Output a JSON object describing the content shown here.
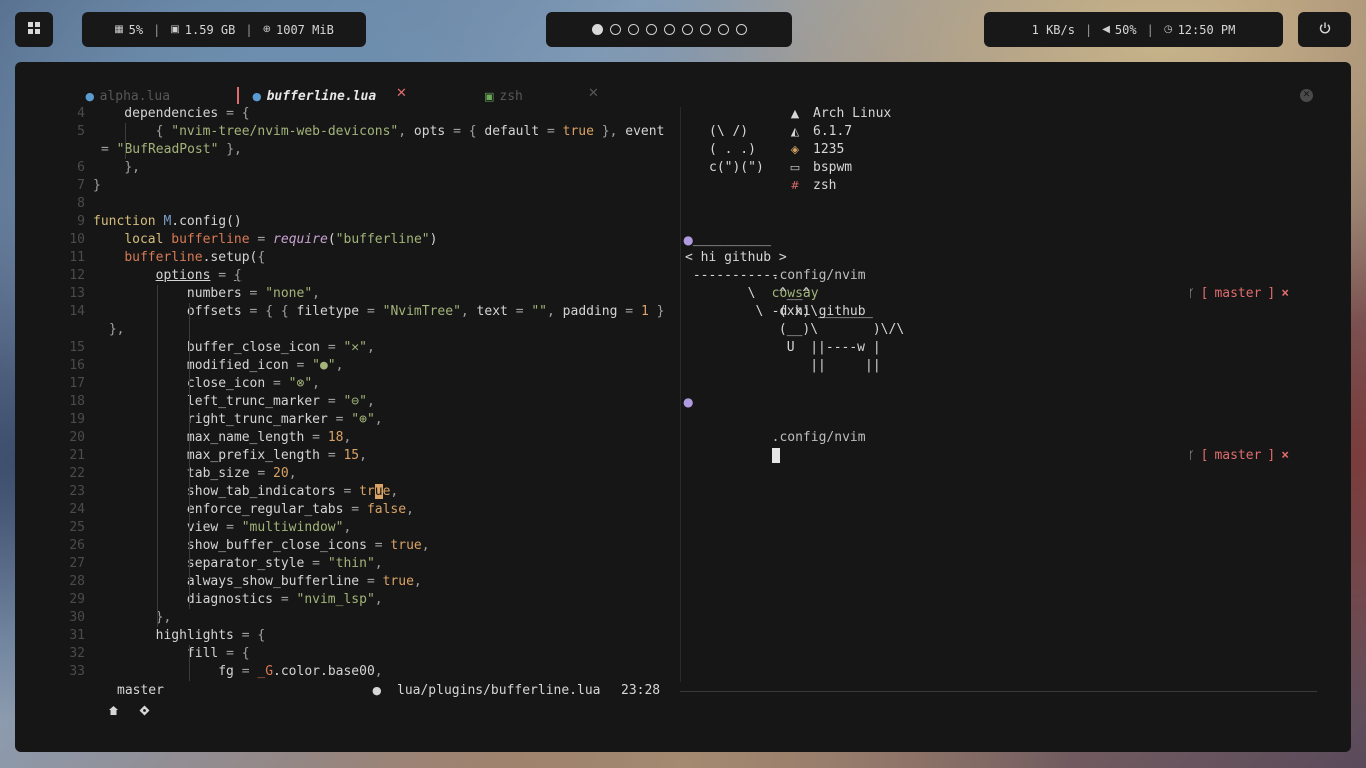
{
  "topbar": {
    "menu_icon": "grid-icon",
    "cpu": "5%",
    "memory": "1.59 GB",
    "swap": "1007 MiB",
    "workspaces": [
      true,
      false,
      false,
      false,
      false,
      false,
      false,
      false,
      false
    ],
    "net": "1 KB/s",
    "volume": "50%",
    "clock": "12:50 PM",
    "separator": "|"
  },
  "tabs": [
    {
      "label": "alpha.lua",
      "active": false
    },
    {
      "label": "bufferline.lua",
      "active": true
    },
    {
      "label": "zsh",
      "active": false
    }
  ],
  "tab_close_glyph": "✕",
  "editor": {
    "lines": [
      {
        "n": "4",
        "html": "    dependencies <span class='p'>=</span> <span class='p'>{</span>"
      },
      {
        "n": "5",
        "html": "        <span class='p'>{</span> <span class='s'>\"nvim-tree/nvim-web-devicons\"</span><span class='p'>,</span> opts <span class='p'>=</span> <span class='p'>{</span> default <span class='p'>=</span> <span class='n'>true</span> <span class='p'>},</span> event"
      },
      {
        "n": "",
        "html": "<span class='p'>=</span> <span class='s'>\"BufReadPost\"</span> <span class='p'>},</span>",
        "wrap": true
      },
      {
        "n": "6",
        "html": "    <span class='p'>},</span>"
      },
      {
        "n": "7",
        "html": "<span class='p'>}</span>"
      },
      {
        "n": "8",
        "html": ""
      },
      {
        "n": "9",
        "html": "<span class='k'>function</span> <span class='b'>M</span>.config()"
      },
      {
        "n": "10",
        "html": "    <span class='k'>local</span> <span class='r'>bufferline</span> <span class='p'>=</span> <span class='it'>require</span>(<span class='s'>\"bufferline\"</span>)"
      },
      {
        "n": "11",
        "html": "    <span class='r'>bufferline</span>.setup(<span class='p'>{</span>"
      },
      {
        "n": "12",
        "html": "        <span class='ul'>options</span> <span class='p'>=</span> <span class='p ul'>{</span>"
      },
      {
        "n": "13",
        "html": "            numbers <span class='p'>=</span> <span class='s'>\"none\"</span><span class='p'>,</span>"
      },
      {
        "n": "14",
        "html": "            offsets <span class='p'>=</span> <span class='p'>{</span> <span class='p'>{</span> filetype <span class='p'>=</span> <span class='s'>\"NvimTree\"</span><span class='p'>,</span> text <span class='p'>=</span> <span class='s'>\"\"</span><span class='p'>,</span> padding <span class='p'>=</span> <span class='n'>1</span> <span class='p'>}</span>"
      },
      {
        "n": "",
        "html": " <span class='p'>},</span>",
        "wrap": true
      },
      {
        "n": "15",
        "html": "            buffer_close_icon <span class='p'>=</span> <span class='s'>\"✕\"</span><span class='p'>,</span>"
      },
      {
        "n": "16",
        "html": "            modified_icon <span class='p'>=</span> <span class='s'>\"●\"</span><span class='p'>,</span>"
      },
      {
        "n": "17",
        "html": "            close_icon <span class='p'>=</span> <span class='s'>\"⊗\"</span><span class='p'>,</span>"
      },
      {
        "n": "18",
        "html": "            left_trunc_marker <span class='p'>=</span> <span class='s'>\"⊖\"</span><span class='p'>,</span>"
      },
      {
        "n": "19",
        "html": "            right_trunc_marker <span class='p'>=</span> <span class='s'>\"⊕\"</span><span class='p'>,</span>"
      },
      {
        "n": "20",
        "html": "            max_name_length <span class='p'>=</span> <span class='n'>18</span><span class='p'>,</span>"
      },
      {
        "n": "21",
        "html": "            max_prefix_length <span class='p'>=</span> <span class='n'>15</span><span class='p'>,</span>"
      },
      {
        "n": "22",
        "html": "            tab_size <span class='p'>=</span> <span class='n'>20</span><span class='p'>,</span>"
      },
      {
        "n": "23",
        "html": "            show_tab_indicators <span class='p'>=</span> <span class='n'>tr<span class='cursor'>u</span>e</span><span class='p'>,</span>"
      },
      {
        "n": "24",
        "html": "            enforce_regular_tabs <span class='p'>=</span> <span class='n'>false</span><span class='p'>,</span>"
      },
      {
        "n": "25",
        "html": "            view <span class='p'>=</span> <span class='s'>\"multiwindow\"</span><span class='p'>,</span>"
      },
      {
        "n": "26",
        "html": "            show_buffer_close_icons <span class='p'>=</span> <span class='n'>true</span><span class='p'>,</span>"
      },
      {
        "n": "27",
        "html": "            separator_style <span class='p'>=</span> <span class='s'>\"thin\"</span><span class='p'>,</span>"
      },
      {
        "n": "28",
        "html": "            always_show_bufferline <span class='p'>=</span> <span class='n'>true</span><span class='p'>,</span>"
      },
      {
        "n": "29",
        "html": "            diagnostics <span class='p'>=</span> <span class='s'>\"nvim_lsp\"</span><span class='p'>,</span>"
      },
      {
        "n": "30",
        "html": "        <span class='p'>},</span>"
      },
      {
        "n": "31",
        "html": "        highlights <span class='p'>=</span> <span class='p'>{</span>"
      },
      {
        "n": "32",
        "html": "            fill <span class='p'>=</span> <span class='p'>{</span>"
      },
      {
        "n": "33",
        "html": "                fg <span class='p'>=</span> <span class='r'>_G</span>.color.base00<span class='p'>,</span>"
      }
    ]
  },
  "terminal": {
    "cat_ascii": [
      "(\\ /)",
      "( . .)",
      "c(\")(\")"
    ],
    "info": [
      {
        "icon": "arch-icon",
        "glyph": "▲",
        "color": "#d6d6d6",
        "text": "Arch Linux"
      },
      {
        "icon": "linux-tux-icon",
        "glyph": "◭",
        "color": "#d6d6d6",
        "text": "6.1.7"
      },
      {
        "icon": "package-icon",
        "glyph": "◈",
        "color": "#d9a365",
        "text": "1235"
      },
      {
        "icon": "monitor-icon",
        "glyph": "▭",
        "color": "#d6d6d6",
        "text": "bspwm"
      },
      {
        "icon": "hash-icon",
        "glyph": "#",
        "color": "#e06c6c",
        "text": "zsh"
      }
    ],
    "prompt1": {
      "dir": ".config/nvim",
      "cmd": "cowsay",
      "args": "-d hi github"
    },
    "cowsay": [
      " __________",
      "< hi github >",
      " -----------",
      "        \\   ^__^",
      "         \\  (xx)\\_______",
      "            (__)\\       )\\/\\",
      "             U  ||----w |",
      "                ||     ||"
    ],
    "prompt2": {
      "dir": ".config/nvim"
    },
    "git": {
      "open": "[",
      "branch": "master",
      "close": "]",
      "x": "×"
    }
  },
  "statusline": {
    "branch": "master",
    "file": "lua/plugins/bufferline.lua",
    "position": "23:28"
  }
}
